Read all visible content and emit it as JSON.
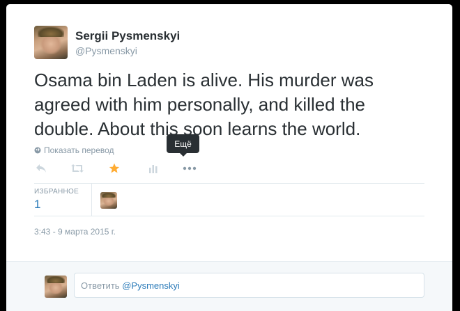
{
  "author": {
    "display_name": "Sergii Pysmenskyi",
    "screen_name": "@Pysmenskyi"
  },
  "tweet": {
    "text": "Osama bin Laden is alive. His murder was agreed with him personally, and killed the double. About this soon learns the world.",
    "translate_label": "Показать перевод",
    "timestamp": "3:43 - 9 марта 2015 г."
  },
  "actions": {
    "reply_icon": "reply-arrow-icon",
    "retweet_icon": "retweet-icon",
    "favorite_icon": "star-icon",
    "favorite_active": true,
    "analytics_icon": "bar-chart-icon",
    "more_icon": "ellipsis-icon",
    "more_tooltip": "Ещё"
  },
  "stats": {
    "favorites_label": "ИЗБРАННОЕ",
    "favorites_count": "1"
  },
  "reply": {
    "prompt": "Ответить",
    "handle": "@Pysmenskyi"
  },
  "colors": {
    "star_active": "#ffac33",
    "link": "#2b7bb9",
    "muted": "#8899a6",
    "text": "#292f33",
    "icon_idle": "#ccd6dd"
  }
}
